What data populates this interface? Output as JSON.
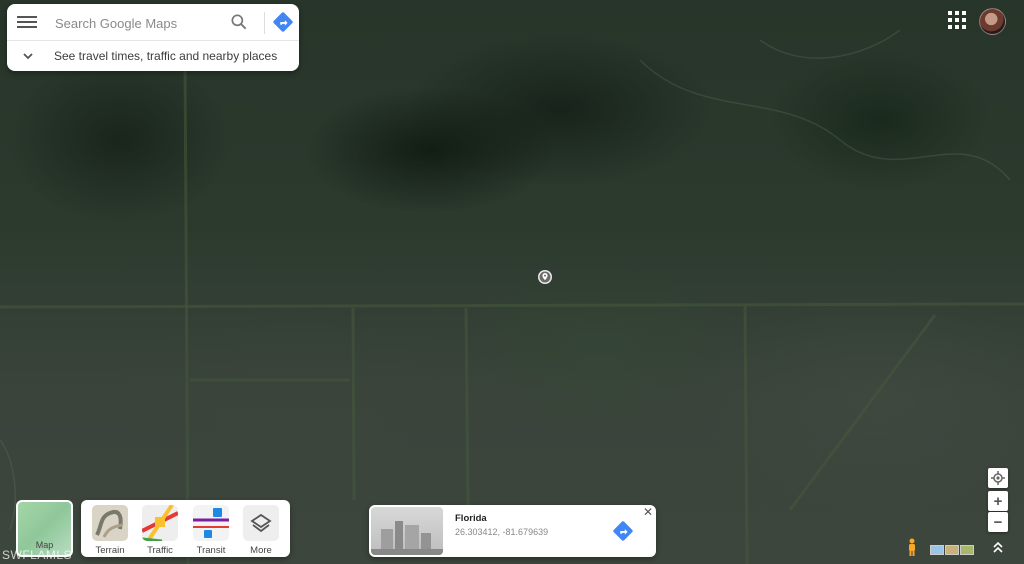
{
  "search": {
    "placeholder": "Search Google Maps",
    "expand_label": "See travel times, traffic and nearby places"
  },
  "icons": {
    "menu": "hamburger-menu-icon",
    "search": "magnifier-icon",
    "directions": "directions-arrow-icon",
    "chevron": "chevron-down-icon",
    "apps": "apps-grid-icon",
    "pin": "location-pin-icon",
    "my_location": "my-location-icon",
    "pegman": "pegman-icon",
    "expand": "double-chevron-up-icon",
    "close": "close-icon"
  },
  "layers": {
    "map_toggle_label": "Map",
    "items": [
      {
        "label": "Terrain"
      },
      {
        "label": "Traffic"
      },
      {
        "label": "Transit"
      },
      {
        "label": "More"
      }
    ]
  },
  "info_card": {
    "title": "Florida",
    "coordinates": "26.303412, -81.679639",
    "close": "✕"
  },
  "zoom": {
    "in": "+",
    "out": "−"
  },
  "watermark": "SWFLAMLS",
  "colors": {
    "brand_blue": "#4285f4",
    "map_green": "#2c3a2e"
  }
}
